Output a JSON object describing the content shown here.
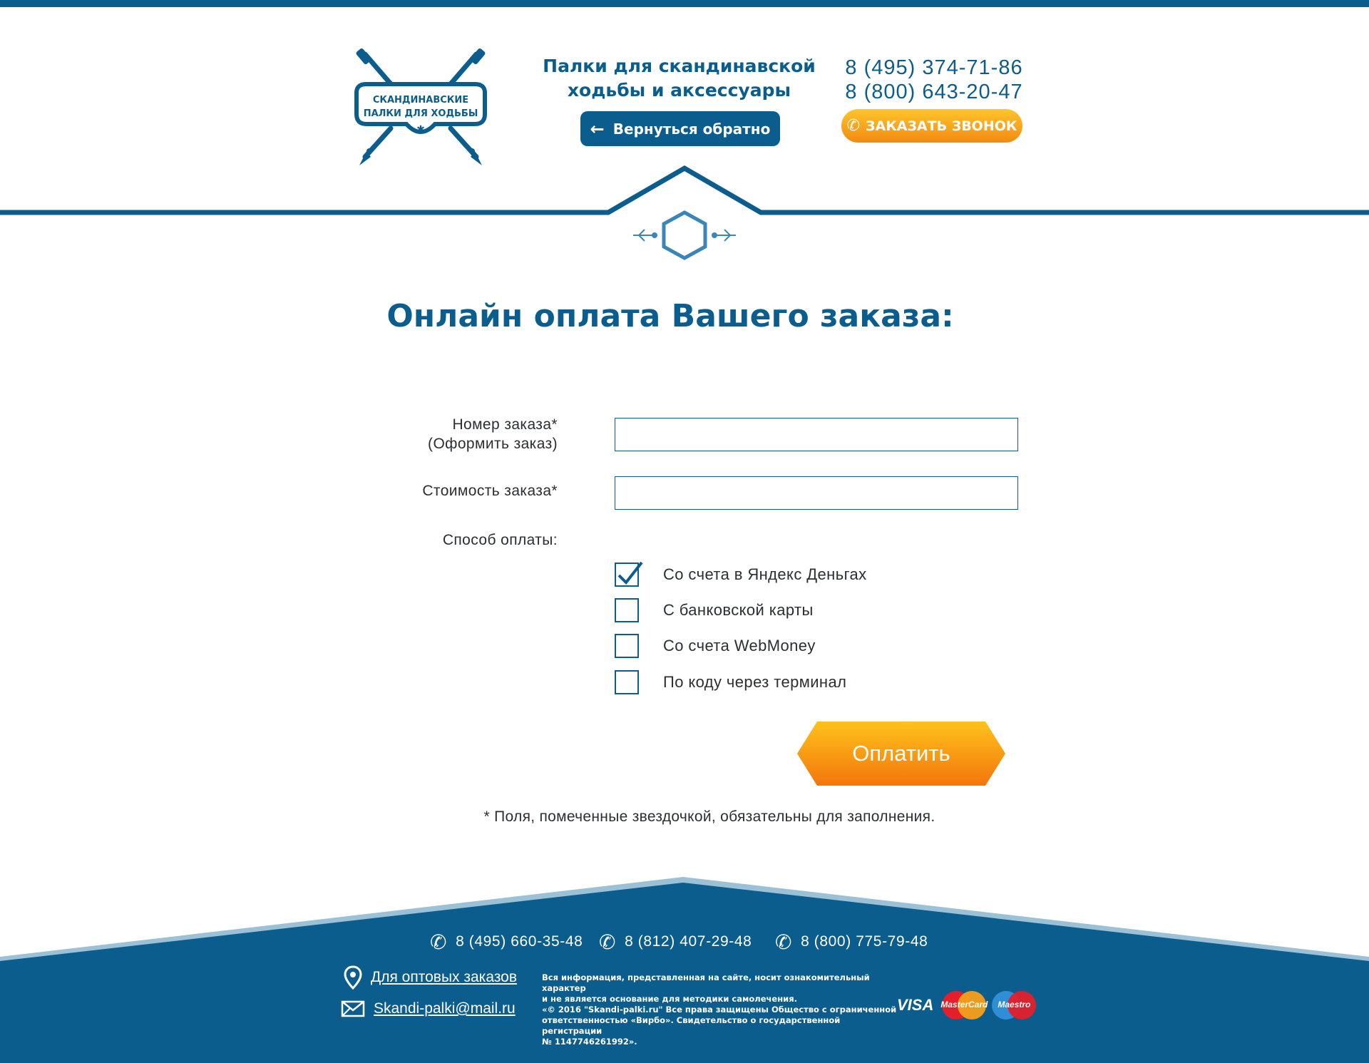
{
  "header": {
    "logo": {
      "line1": "СКАНДИНАВСКИЕ",
      "line2": "ПАЛКИ ДЛЯ ХОДЬБЫ"
    },
    "tagline_line1": "Палки для скандинавской",
    "tagline_line2": "ходьбы и аксессуары",
    "back_button": "Вернуться обратно",
    "phone1": "8 (495) 374-71-86",
    "phone2": "8 (800) 643-20-47",
    "callback_button": "ЗАКАЗАТЬ ЗВОНОК"
  },
  "main": {
    "title": "Онлайн оплата Вашего заказа:",
    "form": {
      "order_number_label_line1": "Номер заказа*",
      "order_number_label_line2": "(Оформить заказ)",
      "order_number_value": "",
      "order_cost_label": "Стоимость заказа*",
      "order_cost_value": "",
      "payment_method_label": "Способ оплаты:",
      "payment_options": [
        {
          "label": "Со счета в Яндекс Деньгах",
          "checked": true
        },
        {
          "label": "С банковской карты",
          "checked": false
        },
        {
          "label": "Со счета WebMoney",
          "checked": false
        },
        {
          "label": "По коду через терминал",
          "checked": false
        }
      ],
      "pay_button": "Оплатить",
      "required_note": "* Поля, помеченные звездочкой, обязательны для заполнения."
    }
  },
  "footer": {
    "phones": [
      "8 (495) 660-35-48",
      "8 (812) 407-29-48",
      "8 (800) 775-79-48"
    ],
    "wholesale_link": "Для оптовых заказов",
    "email_link": "Skandi-palki@mail.ru",
    "legal_line1": "Вся информация, представленная на сайте, носит ознакомительный характер",
    "legal_line2": "и не является основание для методики самолечения.",
    "copyright_line1": "«© 2016 \"Skandi-palki.ru\" Все права защищены Общество с ограниченной",
    "copyright_line2": "ответственностью «Вирбо». Свидетельство о государственной регистрации",
    "copyright_line3": "№ 1147746261992».",
    "payment_logos": {
      "visa": "VISA",
      "mastercard": "MasterCard",
      "maestro": "Maestro"
    }
  },
  "colors": {
    "brand_blue": "#0b5d8e",
    "accent_orange": "#f28a12",
    "footer_blue": "#0b5d8e",
    "footer_light": "#9cc0d6"
  }
}
